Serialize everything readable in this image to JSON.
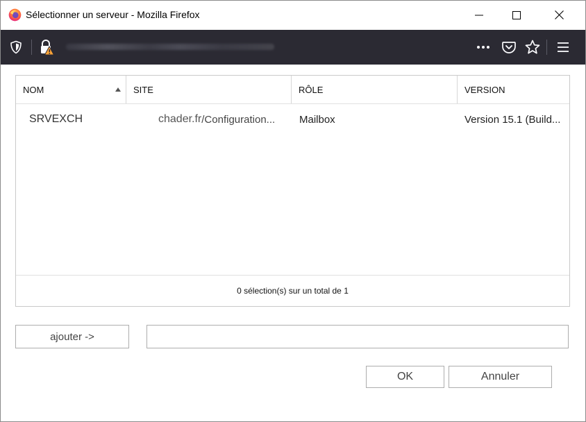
{
  "window": {
    "title": "Sélectionner un serveur - Mozilla Firefox",
    "controls": {
      "minimize": "minimize-icon",
      "maximize": "maximize-icon",
      "close": "close-icon"
    }
  },
  "urlbar": {
    "icons": [
      "shield-icon",
      "insecure-lock-icon",
      "more-icon",
      "pocket-icon",
      "star-icon",
      "hamburger-menu-icon"
    ]
  },
  "grid": {
    "columns": [
      "NOM",
      "SITE",
      "RÔLE",
      "VERSION"
    ],
    "sort": {
      "column": "NOM",
      "direction": "ascending"
    },
    "rows": [
      {
        "nom": "SRVEXCH",
        "site_prefix": "chader.fr",
        "site_rest": "/Configuration...",
        "role": "Mailbox",
        "version": "Version 15.1 (Build..."
      }
    ],
    "footer": "0 sélection(s) sur un total de 1"
  },
  "add": {
    "button_label": "ajouter ->",
    "field_value": ""
  },
  "buttons": {
    "ok": "OK",
    "cancel": "Annuler"
  },
  "colors": {
    "urlbar_bg": "#2b2a33",
    "lock_warning": "#ffa436",
    "firefox_orange": "#ff7139"
  }
}
